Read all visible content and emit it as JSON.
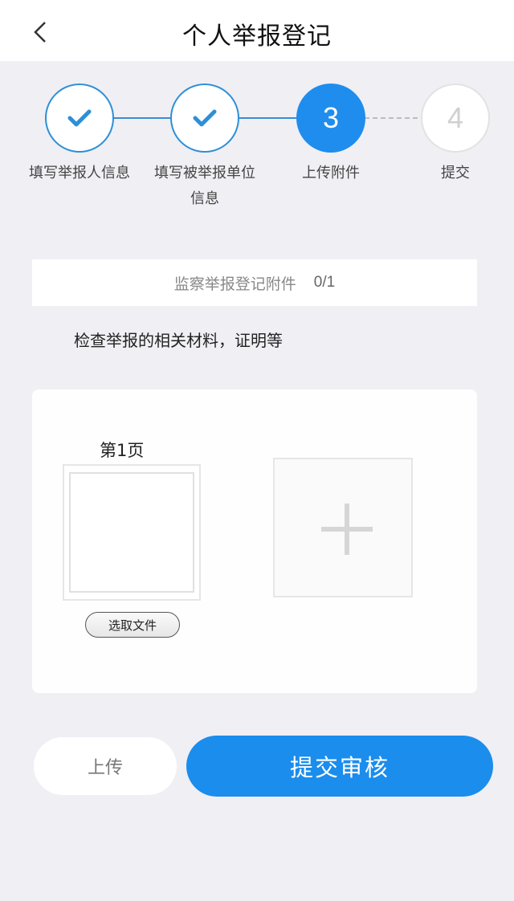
{
  "header": {
    "title": "个人举报登记",
    "back_icon": "chevron-left-icon"
  },
  "stepper": {
    "steps": [
      {
        "label": "填写举报人信息",
        "state": "done"
      },
      {
        "label": "填写被举报单位\n信息",
        "state": "done"
      },
      {
        "label": "上传附件",
        "number": "3",
        "state": "active"
      },
      {
        "label": "提交",
        "number": "4",
        "state": "todo"
      }
    ],
    "colors": {
      "active": "#1f8ded",
      "done_border": "#2d8fd8",
      "todo": "#d0d0d0"
    }
  },
  "attachments": {
    "title": "监察举报登记附件",
    "count": "0/1",
    "description": "检查举报的相关材料，证明等"
  },
  "upload_area": {
    "page_label": "第1页",
    "choose_file_label": "选取文件",
    "add_icon": "plus-icon"
  },
  "actions": {
    "upload_label": "上传",
    "submit_label": "提交审核",
    "primary_color": "#1a8ded"
  }
}
